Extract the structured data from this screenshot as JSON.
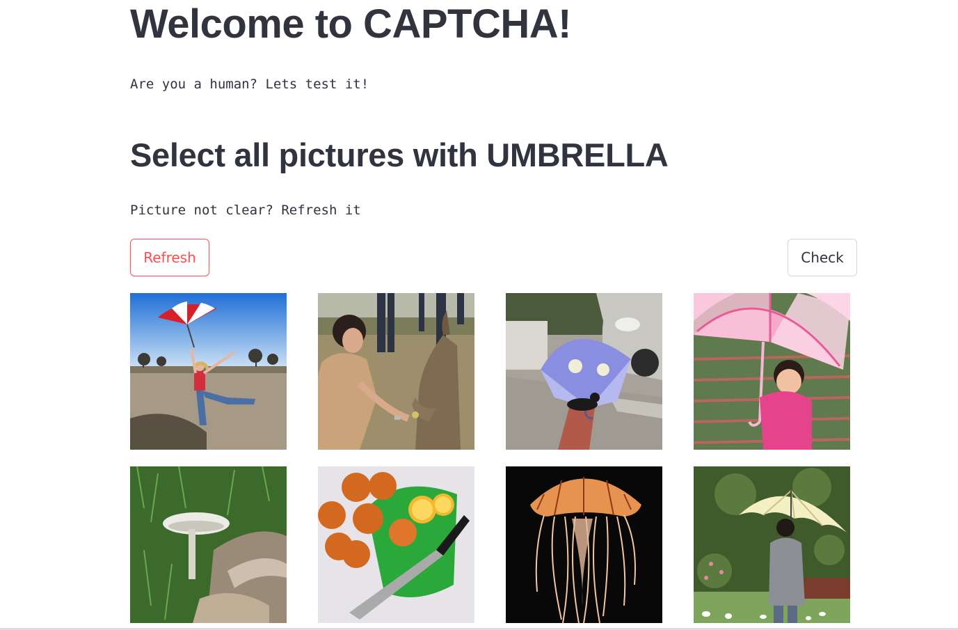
{
  "header": {
    "title": "Welcome to CAPTCHA!",
    "intro_text": "Are you a human? Lets test it!"
  },
  "challenge": {
    "prompt": "Select all pictures with UMBRELLA",
    "hint_text": "Picture not clear? Refresh it"
  },
  "buttons": {
    "refresh_label": "Refresh",
    "check_label": "Check"
  },
  "colors": {
    "text": "#31333f",
    "accent_red": "#ff4b4b",
    "border_gray": "#d6d6d9"
  },
  "images": [
    {
      "subject": "woman-jumping-with-red-white-umbrella",
      "has_umbrella": true
    },
    {
      "subject": "woman-feeding-kangaroo",
      "has_umbrella": false
    },
    {
      "subject": "cat-under-blue-umbrella-by-car",
      "has_umbrella": true
    },
    {
      "subject": "child-with-pink-umbrella",
      "has_umbrella": true
    },
    {
      "subject": "white-mushroom-in-grass",
      "has_umbrella": false
    },
    {
      "subject": "oranges-and-knife-on-cutting-board",
      "has_umbrella": false
    },
    {
      "subject": "jellyfish-on-black-background",
      "has_umbrella": false
    },
    {
      "subject": "boy-with-cream-umbrella-in-garden",
      "has_umbrella": true
    }
  ]
}
